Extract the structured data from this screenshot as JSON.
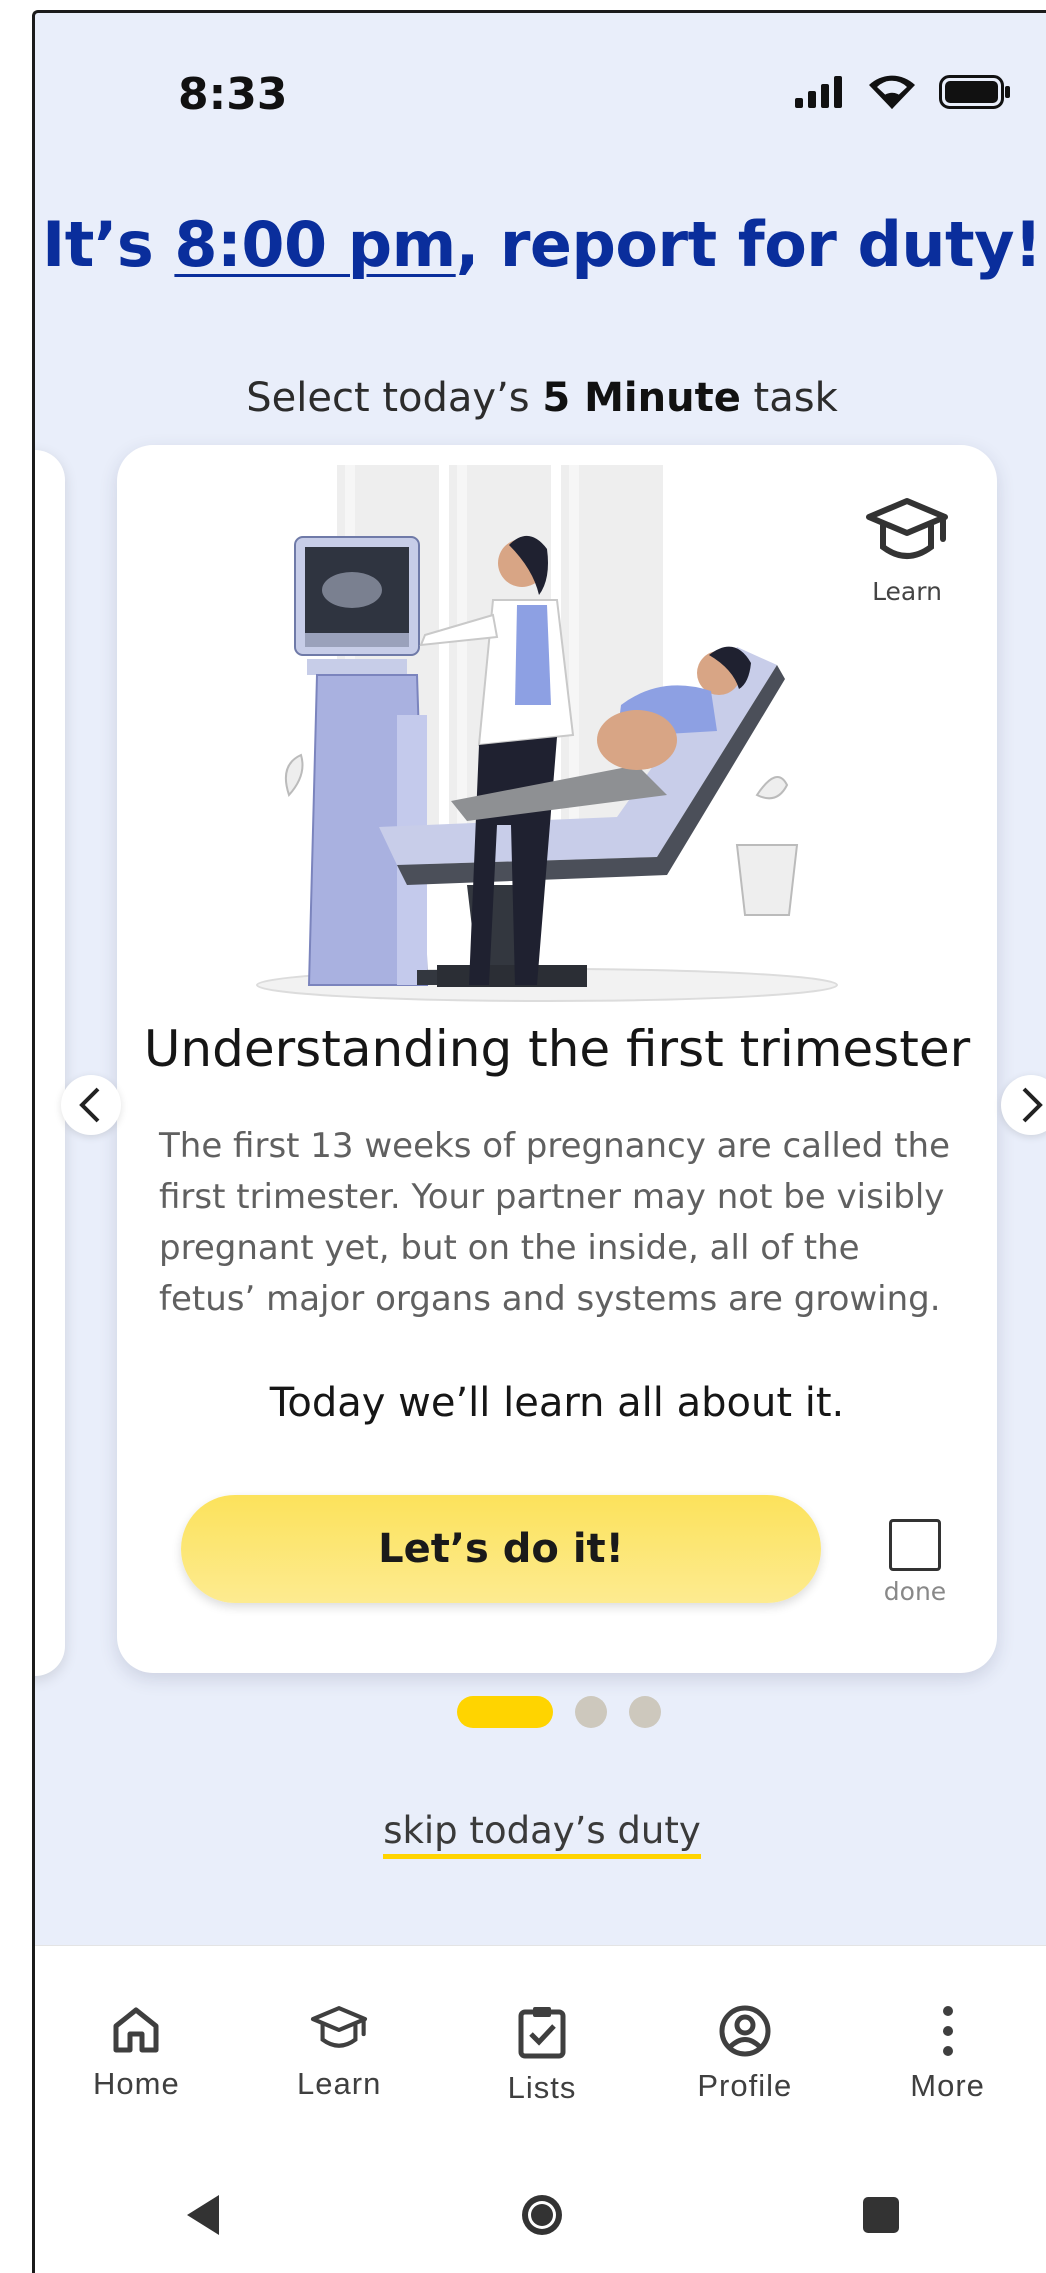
{
  "status_bar": {
    "time": "8:33",
    "icons": [
      "signal-icon",
      "wifi-icon",
      "battery-icon"
    ]
  },
  "header": {
    "prefix": "It’s ",
    "time": "8:00 pm",
    "suffix": ", report for duty!",
    "subtitle_pre": "Select today’s ",
    "subtitle_bold": "5 Minute",
    "subtitle_post": " task"
  },
  "card": {
    "badge_label": "Learn",
    "badge_icon": "graduation-cap-icon",
    "title": "Understanding the first trimester",
    "description": "The first 13 weeks of pregnancy are called the first trimester. Your partner may not be visibly pregnant yet, but on the inside, all of the fetus’ major organs and systems are growing.",
    "cta_line": "Today we’ll learn all about it.",
    "cta_button": "Let’s do it!",
    "done_label": "done"
  },
  "carousel": {
    "pages": 3,
    "active_index": 0
  },
  "skip_label": "skip today’s duty",
  "bottom_nav": [
    {
      "label": "Home",
      "icon": "home-icon"
    },
    {
      "label": "Learn",
      "icon": "graduation-cap-icon"
    },
    {
      "label": "Lists",
      "icon": "clipboard-check-icon"
    },
    {
      "label": "Profile",
      "icon": "profile-icon"
    },
    {
      "label": "More",
      "icon": "more-vertical-icon"
    }
  ],
  "colors": {
    "accent_blue": "#0a2e9c",
    "accent_yellow": "#ffd400",
    "background": "#e9eefa"
  }
}
